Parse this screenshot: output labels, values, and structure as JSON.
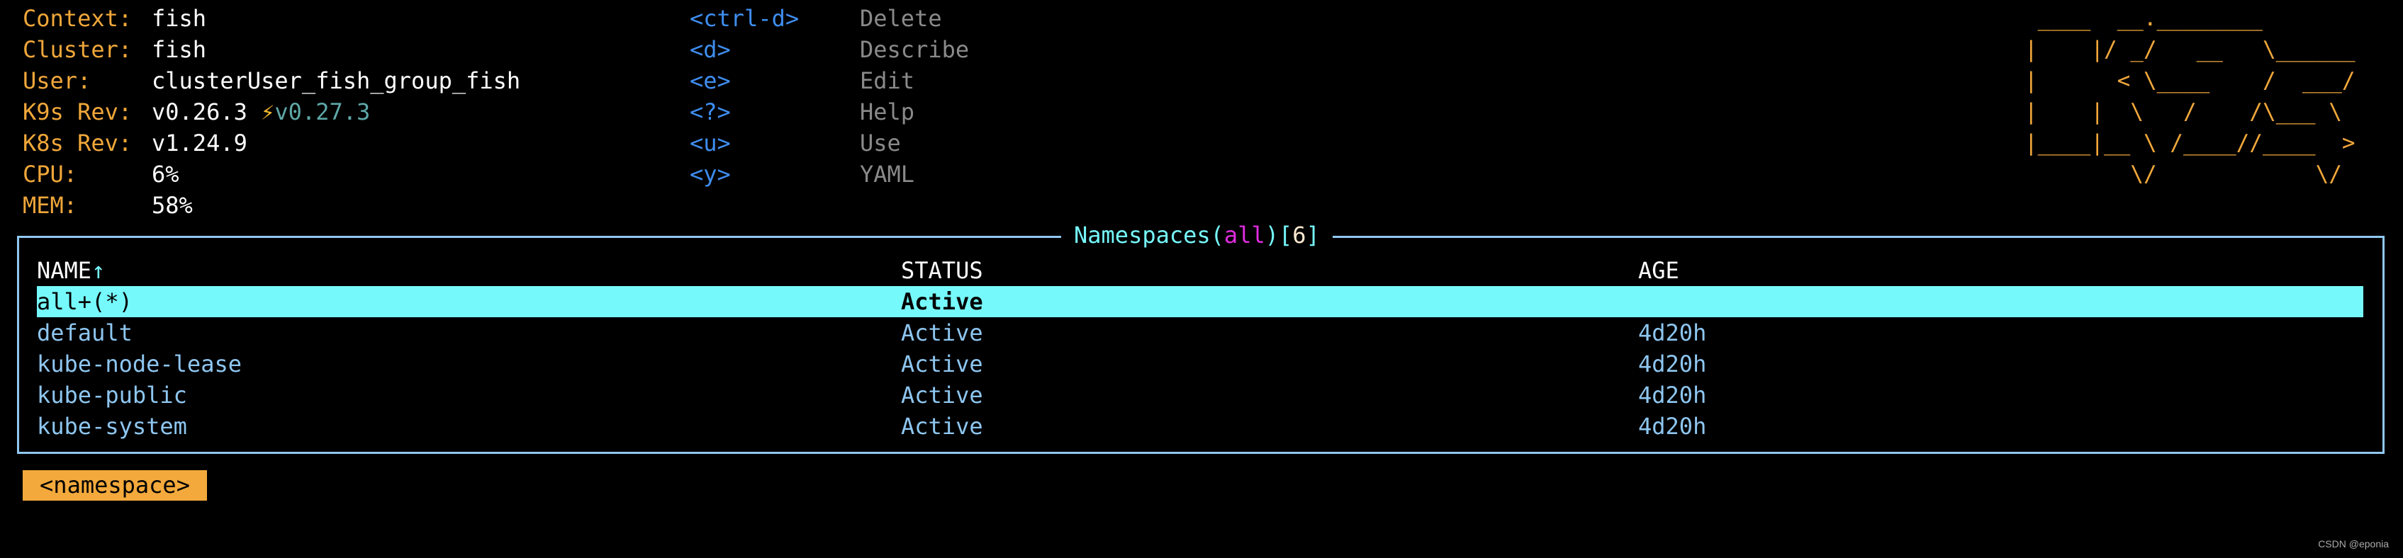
{
  "info": [
    {
      "label": "Context:",
      "value": "fish"
    },
    {
      "label": "Cluster:",
      "value": "fish"
    },
    {
      "label": "User:",
      "value": "clusterUser_fish_group_fish"
    },
    {
      "label": "K9s Rev:",
      "value": "v0.26.3",
      "upgrade_icon": "lightning-icon",
      "upgrade": "v0.27.3"
    },
    {
      "label": "K8s Rev:",
      "value": "v1.24.9"
    },
    {
      "label": "CPU:",
      "value": "6%"
    },
    {
      "label": "MEM:",
      "value": "58%"
    }
  ],
  "shortcuts": [
    {
      "key": "<ctrl-d>",
      "action": "Delete"
    },
    {
      "key": "<d>",
      "action": "Describe"
    },
    {
      "key": "<e>",
      "action": "Edit"
    },
    {
      "key": "<?>",
      "action": "Help"
    },
    {
      "key": "<u>",
      "action": "Use"
    },
    {
      "key": "<y>",
      "action": "YAML"
    }
  ],
  "logo": " ____  __.________       \n|    |/ _/   __   \\______\n|      < \\____    /  ___/\n|    |  \\   /    /\\___ \\ \n|____|__ \\ /____//____  >\n        \\/            \\/ ",
  "table": {
    "title": "Namespaces",
    "namespace": "all",
    "count": "6",
    "columns": [
      "NAME",
      "STATUS",
      "AGE"
    ],
    "sort_indicator": "↑",
    "rows": [
      {
        "name": "all+(*)",
        "status": "Active",
        "age": ""
      },
      {
        "name": "default",
        "status": "Active",
        "age": "4d20h"
      },
      {
        "name": "kube-node-lease",
        "status": "Active",
        "age": "4d20h"
      },
      {
        "name": "kube-public",
        "status": "Active",
        "age": "4d20h"
      },
      {
        "name": "kube-system",
        "status": "Active",
        "age": "4d20h"
      }
    ]
  },
  "breadcrumb": "<namespace>",
  "watermark": "CSDN @eponia",
  "colors": {
    "accent": "#f0a73a",
    "highlight": "#76f9fb",
    "border": "#90c8f0",
    "key": "#3f8ef0"
  }
}
